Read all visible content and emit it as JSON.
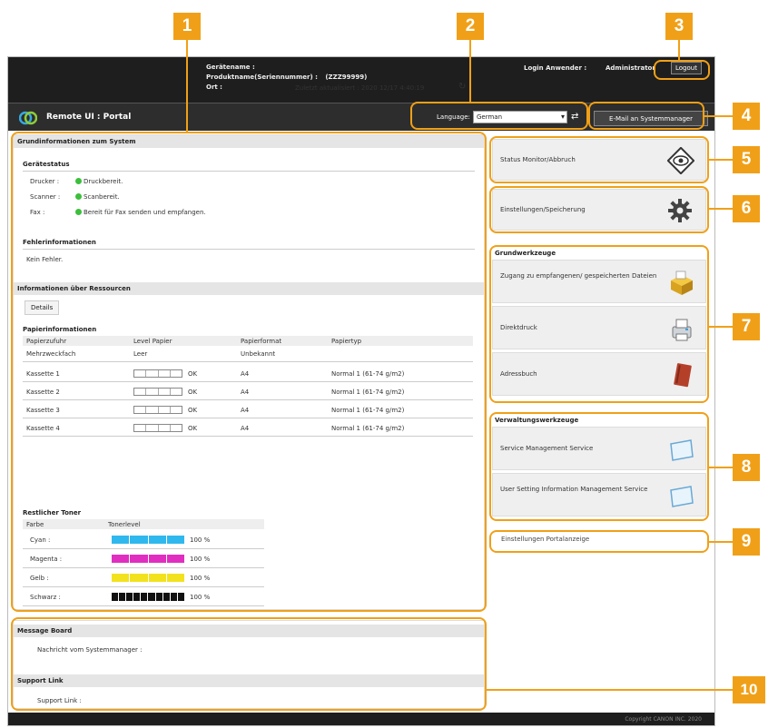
{
  "device_info": {
    "device_name_label": "Gerätename :",
    "product_label": "Produktname(Seriennummer) :",
    "product_value": "(ZZZ99999)",
    "location_label": "Ort :"
  },
  "login": {
    "user_label": "Login Anwender :",
    "user_value": "Administrator",
    "logout_label": "Logout"
  },
  "header": {
    "title": "Remote UI : Portal",
    "language_label": "Language:",
    "language_value": "German",
    "email_button": "E-Mail an Systemmanager"
  },
  "updated_text": "Zuletzt aktualisiert : 2020 12/17 4:40:19",
  "system_info": {
    "title": "Grundinformationen zum System",
    "device_status_title": "Gerätestatus",
    "statuses": [
      {
        "label": "Drucker :",
        "value": "Druckbereit."
      },
      {
        "label": "Scanner :",
        "value": "Scanbereit."
      },
      {
        "label": "Fax :",
        "value": "Bereit für Fax senden und empfangen."
      }
    ],
    "error_title": "Fehlerinformationen",
    "error_value": "Kein Fehler.",
    "resources_title": "Informationen über Ressourcen",
    "details_button": "Details",
    "paper_title": "Papierinformationen",
    "paper_headers": [
      "Papierzufuhr",
      "Level Papier",
      "Papierformat",
      "Papiertyp"
    ],
    "paper_rows": [
      {
        "source": "Mehrzweckfach",
        "level": "Leer",
        "format": "Unbekannt",
        "type": "",
        "gauge": false
      },
      {
        "source": "Kassette 1",
        "level": "OK",
        "format": "A4",
        "type": "Normal 1 (61-74 g/m2)",
        "gauge": true
      },
      {
        "source": "Kassette 2",
        "level": "OK",
        "format": "A4",
        "type": "Normal 1 (61-74 g/m2)",
        "gauge": true
      },
      {
        "source": "Kassette 3",
        "level": "OK",
        "format": "A4",
        "type": "Normal 1 (61-74 g/m2)",
        "gauge": true
      },
      {
        "source": "Kassette 4",
        "level": "OK",
        "format": "A4",
        "type": "Normal 1 (61-74 g/m2)",
        "gauge": true
      }
    ],
    "toner_title": "Restlicher Toner",
    "toner_headers": [
      "Farbe",
      "Tonerlevel"
    ],
    "toner_rows": [
      {
        "color": "Cyan :",
        "percent": "100 %",
        "hex": "#2fb8ee",
        "level": 1.0
      },
      {
        "color": "Magenta :",
        "percent": "100 %",
        "hex": "#e02ec0",
        "level": 1.0
      },
      {
        "color": "Gelb :",
        "percent": "100 %",
        "hex": "#f2e21e",
        "level": 1.0
      },
      {
        "color": "Schwarz :",
        "percent": "100 %",
        "hex": "#111111",
        "level": 1.0
      }
    ]
  },
  "message_board": {
    "title": "Message Board",
    "text": "Nachricht vom Systemmanager :",
    "support_title": "Support Link",
    "support_text": "Support Link :"
  },
  "right": {
    "status_monitor": "Status Monitor/Abbruch",
    "settings": "Einstellungen/Speicherung",
    "basic_tools_title": "Grundwerkzeuge",
    "basic_tools": [
      "Zugang zu empfangenen/ gespeicherten Dateien",
      "Direktdruck",
      "Adressbuch"
    ],
    "mgmt_title": "Verwaltungswerkzeuge",
    "mgmt_tools": [
      "Service Management Service",
      "User Setting Information Management Service"
    ],
    "portal_settings": "Einstellungen Portalanzeige"
  },
  "footer_text": "Copyright CANON INC. 2020",
  "callouts": [
    "1",
    "2",
    "3",
    "4",
    "5",
    "6",
    "7",
    "8",
    "9",
    "10"
  ],
  "accent_color": "#f0a018"
}
